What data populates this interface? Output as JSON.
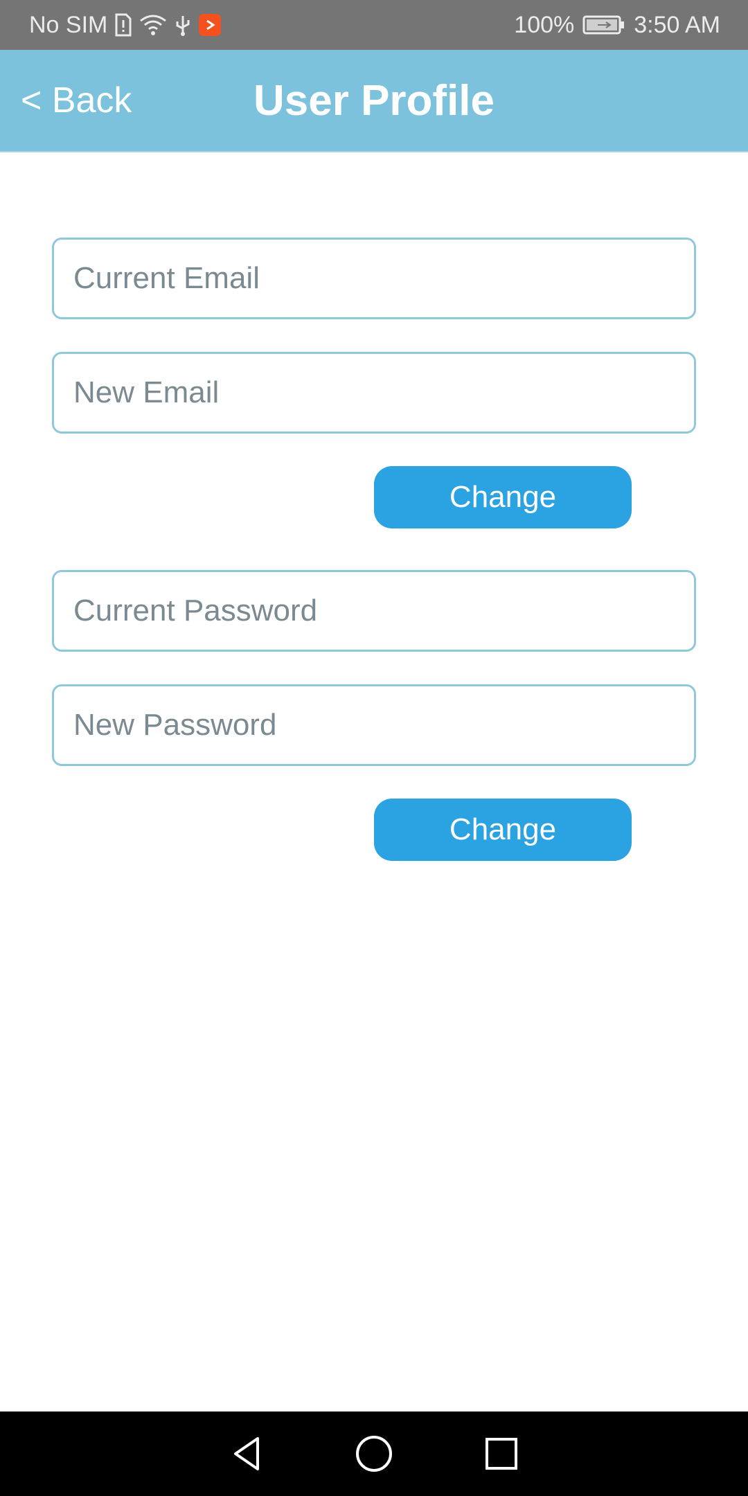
{
  "status_bar": {
    "carrier": "No SIM",
    "battery_percent": "100%",
    "time": "3:50 AM",
    "icons": [
      "sim-alert-icon",
      "wifi-icon",
      "usb-icon",
      "app-notification-icon",
      "battery-charging-icon"
    ]
  },
  "header": {
    "back_label": "< Back",
    "title": "User Profile"
  },
  "email_section": {
    "current_placeholder": "Current Email",
    "new_placeholder": "New Email",
    "current_value": "",
    "new_value": "",
    "button_label": "Change"
  },
  "password_section": {
    "current_placeholder": "Current Password",
    "new_placeholder": "New Password",
    "current_value": "",
    "new_value": "",
    "button_label": "Change"
  },
  "nav_bar": {
    "icons": [
      "back-triangle-icon",
      "home-circle-icon",
      "recents-square-icon"
    ]
  },
  "colors": {
    "header_bg": "#7cc2dc",
    "button_bg": "#2ba3e3",
    "field_border": "#8fc8da",
    "status_bar_bg": "#757575"
  }
}
